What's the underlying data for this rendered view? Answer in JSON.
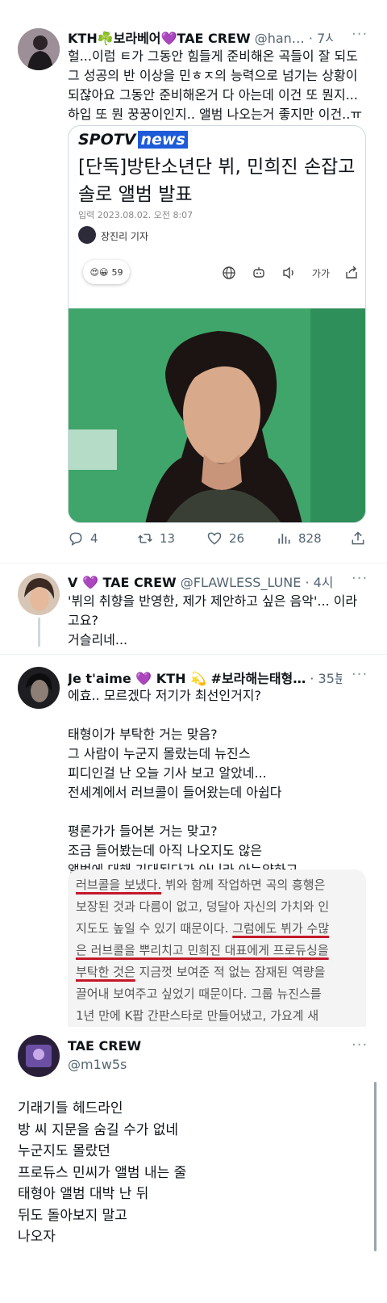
{
  "tweet1": {
    "name": "KTH☘️보라베어💜TAE CREW",
    "handle": "@han…",
    "time": "· 7시",
    "text": "헐...이럼 ㅌ가 그동안 힘들게 준비해온 곡들이 잘 되도\n그 성공의 반 이상을 민ㅎㅈ의 능력으로 넘기는 상황이\n되잖아요 그동안 준비해온거 다 아는데 이건 또 뭔지...\n하입 또 뭔 꿍꿍이인지.. 앨범 나오는거 좋지만 이건..ㅠ",
    "article": {
      "logo_a": "SPO",
      "logo_b": "TV",
      "logo_c": "news",
      "headline": "[단독]방탄소년단 뷔, 민희진 손잡고\n솔로 앨범 발표",
      "date": "입력 2023.08.02. 오전 8:07",
      "reporter": "장진리 기자",
      "reactions": "59",
      "font_label": "가가"
    },
    "stats": {
      "replies": "4",
      "retweets": "13",
      "likes": "26",
      "views": "828"
    }
  },
  "tweet2": {
    "name": "V 💜 TAE CREW",
    "handle": "@FLAWLESS_LUNE",
    "time": "· 4시",
    "text": "'뷔의 취향을 반영한, 제가 제안하고 싶은 음악'... 이라\n고요?\n거슬리네..."
  },
  "tweet3": {
    "name": "Je t'aime 💜 KTH 💫 #보라해는태형…",
    "time": "· 35분",
    "text": "에효.. 모르겠다 저기가 최선인거지?\n\n태형이가 부탁한 거는 맞음?\n그 사람이 누군지 몰랐는데 뉴진스\n피디인걸 난 오늘 기사 보고 알았네...\n전세계에서 러브콜이 들어왔는데 아쉽다\n\n평론가가 들어본 거는 맞고?\n조금 들어봤는데 아직 나오지도 않은\n앨범에 대해 기대된다가 아니라 아는양하고",
    "excerpt": {
      "l1a": "러브콜을 보냈다.",
      "l1b": " 뷔와 함께 작업하면 곡의 흥행은",
      "l2": "보장된 것과 다름이 없고, 덩달아 자신의 가치와 인",
      "l3a": "지도도 높일 수 있기 때문이다. ",
      "l3b": "그럼에도 뷔가 수많",
      "l4a": "은 러브콜을 뿌리치고 민희진 대표에게 프로듀싱을",
      "l5a": "부탁한 것은",
      "l5b": " 지금껏 보여준 적 없는 잠재된 역량을",
      "l6": "끌어내 보여주고 싶었기 때문이다. 그룹 뉴진스를",
      "l7": "1년 만에 K팝 간판스타로 만들어냈고, 가요계 새"
    }
  },
  "tweet4": {
    "name": "TAE CREW",
    "handle": "@m1w5s",
    "text": "기래기들 헤드라인\n방 씨 지문을 숨길 수가 없네\n누군지도 몰랐던\n프로듀스 민씨가 앨범 내는 줄\n태형아 앨범 대박 난 뒤\n뒤도 돌아보지 말고\n나오자"
  },
  "icons": [
    "reply-icon",
    "retweet-icon",
    "like-icon",
    "views-icon",
    "share-icon",
    "globe-icon",
    "robot-icon",
    "speaker-icon",
    "share-out-icon",
    "more-icon"
  ],
  "colors": {
    "accent_red": "#c4182a",
    "news_blue": "#1e5bd8",
    "photo_bg": "#3fa56b",
    "muted": "#536471"
  }
}
